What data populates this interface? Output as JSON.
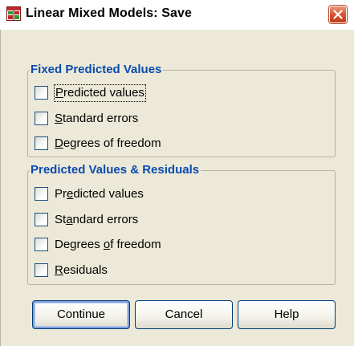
{
  "window": {
    "title": "Linear Mixed Models: Save"
  },
  "groups": {
    "fixed": {
      "title": "Fixed Predicted Values",
      "options": [
        {
          "label": "Predicted values",
          "mnemonic": "P",
          "checked": false,
          "focused": true
        },
        {
          "label": "Standard errors",
          "mnemonic": "S",
          "checked": false
        },
        {
          "label": "Degrees of freedom",
          "mnemonic": "D",
          "checked": false
        }
      ]
    },
    "residual": {
      "title": "Predicted Values & Residuals",
      "options": [
        {
          "label": "Predicted values",
          "mnemonic": "e",
          "checked": false
        },
        {
          "label": "Standard errors",
          "mnemonic": "a",
          "checked": false
        },
        {
          "label": "Degrees of freedom",
          "mnemonic": "o",
          "checked": false
        },
        {
          "label": "Residuals",
          "mnemonic": "R",
          "checked": false
        }
      ]
    }
  },
  "buttons": {
    "continue": "Continue",
    "cancel": "Cancel",
    "help": "Help"
  },
  "icons": {
    "app": "spss-dialog-icon",
    "close": "close-icon"
  },
  "colors": {
    "group_title": "#0a4ab0",
    "dialog_bg": "#ece9d8",
    "close_button": "#d8502d"
  }
}
